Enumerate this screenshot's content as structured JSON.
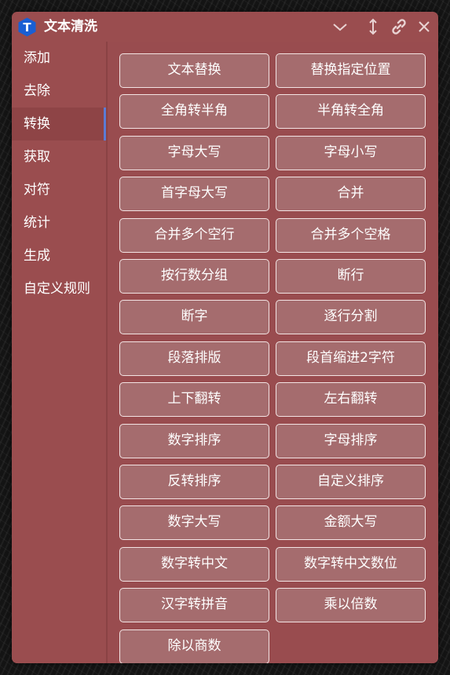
{
  "app": {
    "title": "文本清洗",
    "logo_letter": "T",
    "logo_color": "#1a5fd4"
  },
  "titlebar_icons": [
    "chevron-down-icon",
    "resize-vertical-icon",
    "link-icon",
    "close-icon"
  ],
  "sidebar": {
    "active_index": 2,
    "items": [
      {
        "label": "添加"
      },
      {
        "label": "去除"
      },
      {
        "label": "转换"
      },
      {
        "label": "获取"
      },
      {
        "label": "对符"
      },
      {
        "label": "统计"
      },
      {
        "label": "生成"
      },
      {
        "label": "自定义规则"
      }
    ]
  },
  "main": {
    "buttons": [
      "文本替换",
      "替换指定位置",
      "全角转半角",
      "半角转全角",
      "字母大写",
      "字母小写",
      "首字母大写",
      "合并",
      "合并多个空行",
      "合并多个空格",
      "按行数分组",
      "断行",
      "断字",
      "逐行分割",
      "段落排版",
      "段首缩进2字符",
      "上下翻转",
      "左右翻转",
      "数字排序",
      "字母排序",
      "反转排序",
      "自定义排序",
      "数字大写",
      "金额大写",
      "数字转中文",
      "数字转中文数位",
      "汉字转拼音",
      "乘以倍数",
      "除以商数"
    ]
  },
  "colors": {
    "window_bg": "#9a4d4f",
    "button_bg": "#a56c6e",
    "button_border": "#f3e4e4",
    "active_indicator": "#5b7bd6"
  }
}
